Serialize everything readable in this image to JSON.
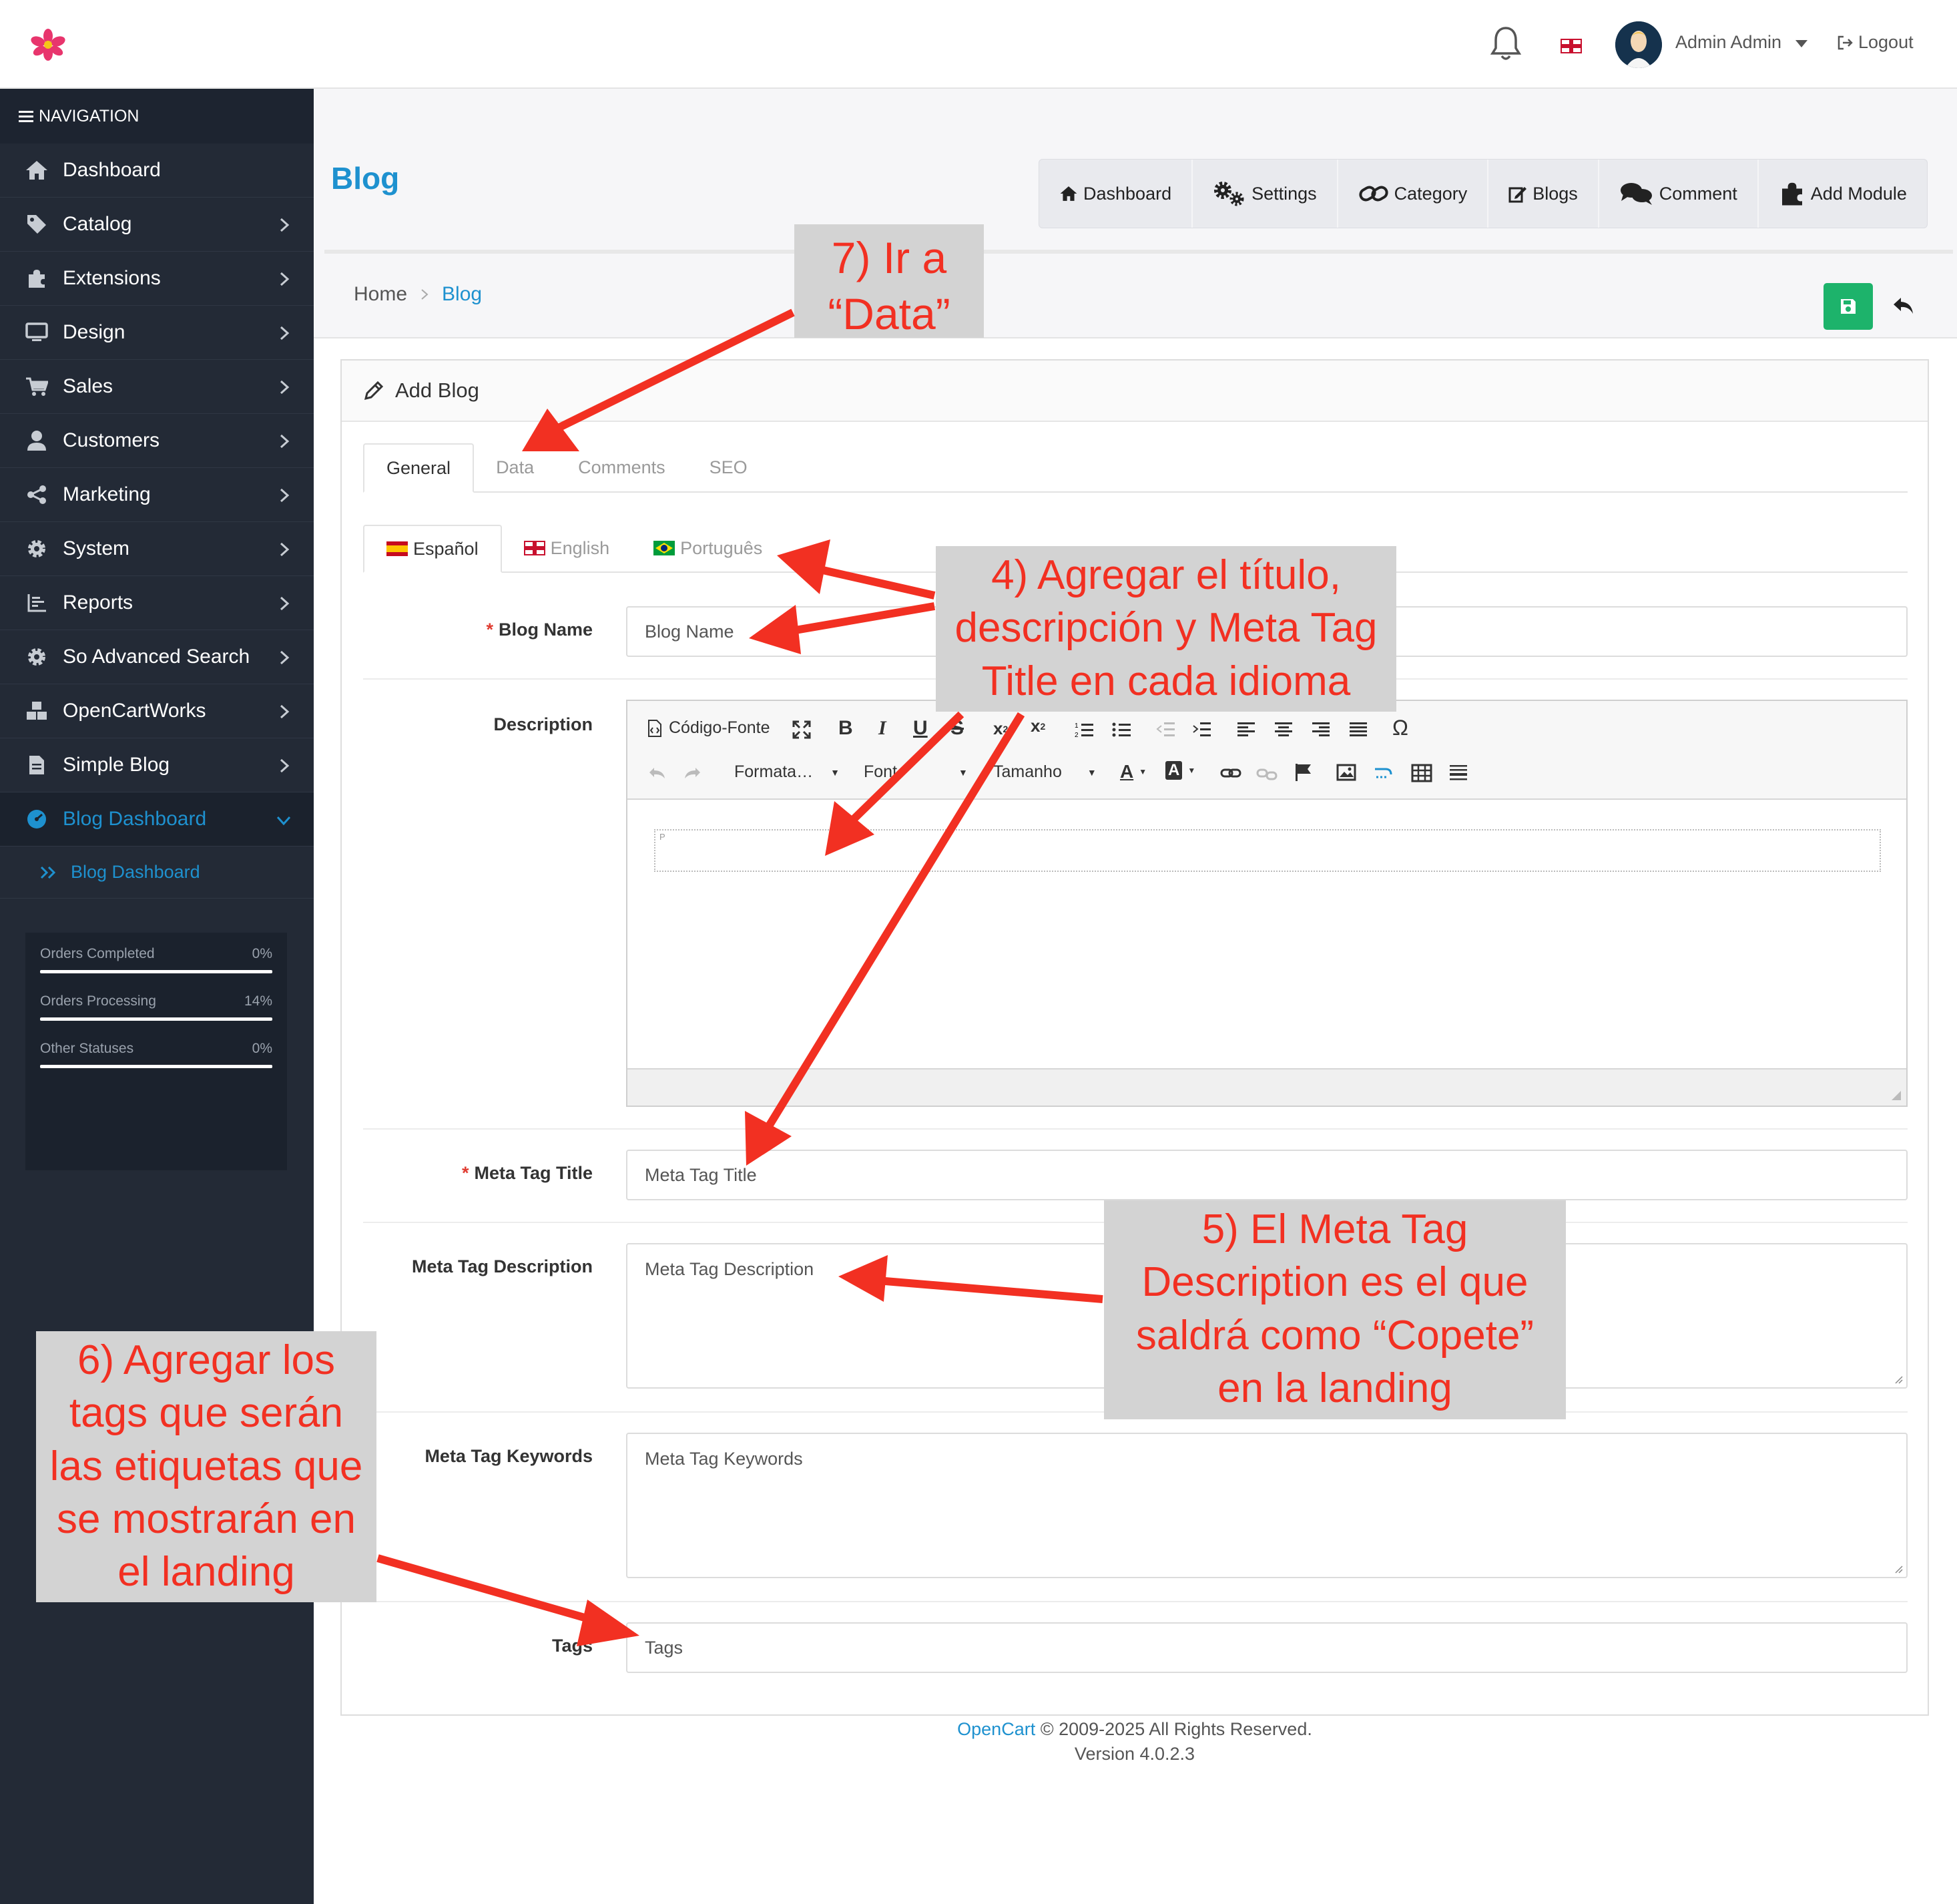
{
  "header": {
    "user_name": "Admin Admin",
    "logout_label": "Logout"
  },
  "sidebar": {
    "nav_header": "NAVIGATION",
    "items": [
      {
        "label": "Dashboard",
        "icon": "home-icon"
      },
      {
        "label": "Catalog",
        "icon": "tag-icon"
      },
      {
        "label": "Extensions",
        "icon": "puzzle-icon"
      },
      {
        "label": "Design",
        "icon": "monitor-icon"
      },
      {
        "label": "Sales",
        "icon": "cart-icon"
      },
      {
        "label": "Customers",
        "icon": "user-icon"
      },
      {
        "label": "Marketing",
        "icon": "share-icon"
      },
      {
        "label": "System",
        "icon": "gear-icon"
      },
      {
        "label": "Reports",
        "icon": "bar-chart-icon"
      },
      {
        "label": "So Advanced Search",
        "icon": "gear-icon"
      },
      {
        "label": "OpenCartWorks",
        "icon": "cubes-icon"
      },
      {
        "label": "Simple Blog",
        "icon": "file-icon"
      },
      {
        "label": "Blog Dashboard",
        "icon": "dashboard-icon"
      }
    ],
    "sub_item": "Blog Dashboard",
    "stats": [
      {
        "label": "Orders Completed",
        "value": "0%"
      },
      {
        "label": "Orders Processing",
        "value": "14%"
      },
      {
        "label": "Other Statuses",
        "value": "0%"
      }
    ]
  },
  "page": {
    "title": "Blog",
    "top_buttons": [
      "Dashboard",
      "Settings",
      "Category",
      "Blogs",
      "Comment",
      "Add Module"
    ],
    "breadcrumb": [
      "Home",
      "Blog"
    ]
  },
  "panel": {
    "heading": "Add Blog",
    "tabs": [
      "General",
      "Data",
      "Comments",
      "SEO"
    ],
    "language_tabs": [
      "Español",
      "English",
      "Português"
    ],
    "fields": {
      "blog_name_label": "Blog Name",
      "blog_name_placeholder": "Blog Name",
      "description_label": "Description",
      "meta_title_label": "Meta Tag Title",
      "meta_title_placeholder": "Meta Tag Title",
      "meta_desc_label": "Meta Tag Description",
      "meta_desc_placeholder": "Meta Tag Description",
      "meta_keywords_label": "Meta Tag Keywords",
      "meta_keywords_placeholder": "Meta Tag Keywords",
      "tags_label": "Tags",
      "tags_placeholder": "Tags"
    },
    "editor": {
      "source_label": "Código-Fonte",
      "format_label": "Formata…",
      "font_label": "Font",
      "size_label": "Tamanho",
      "body_tag": "P"
    }
  },
  "footer": {
    "brand": "OpenCart",
    "copyright": "© 2009-2025 All Rights Reserved.",
    "version": "Version 4.0.2.3"
  },
  "annotations": {
    "step7": [
      "7) Ir a",
      "“Data”"
    ],
    "step4": [
      "4) Agregar el título,",
      "descripción y Meta Tag",
      "Title en cada idioma"
    ],
    "step5": [
      "5) El Meta Tag",
      "Description es el que",
      "saldrá como “Copete”",
      "en la landing"
    ],
    "step6": [
      "6) Agregar los",
      "tags que serán",
      "las etiquetas que",
      "se mostrarán en",
      "el landing"
    ]
  },
  "colors": {
    "sidebar_bg": "#232a36",
    "accent_blue": "#1e91cf",
    "save_green": "#1db36b",
    "annotation_red": "#f23022",
    "annotation_bg": "#d3d3d3"
  }
}
